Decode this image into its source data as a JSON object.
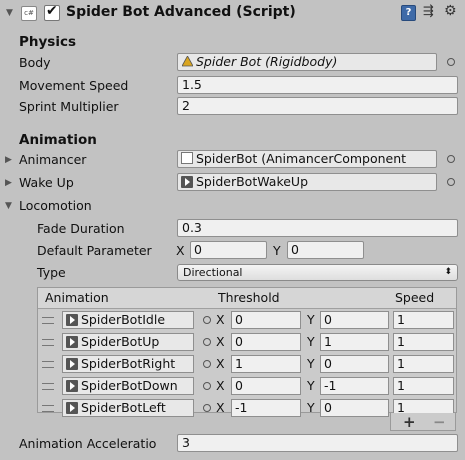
{
  "component": {
    "title": "Spider Bot Advanced (Script)",
    "enabled": true
  },
  "physics": {
    "section_label": "Physics",
    "body": {
      "label": "Body",
      "value": "Spider Bot (Rigidbody)"
    },
    "movement_speed": {
      "label": "Movement Speed",
      "value": "1.5"
    },
    "sprint_multiplier": {
      "label": "Sprint Multiplier",
      "value": "2"
    }
  },
  "animation": {
    "section_label": "Animation",
    "animancer": {
      "label": "Animancer",
      "value": "SpiderBot (AnimancerComponent"
    },
    "wake_up": {
      "label": "Wake Up",
      "value": "SpiderBotWakeUp"
    },
    "locomotion": {
      "label": "Locomotion",
      "fade_duration": {
        "label": "Fade Duration",
        "value": "0.3"
      },
      "default_parameter": {
        "label": "Default Parameter",
        "x_label": "X",
        "x": "0",
        "y_label": "Y",
        "y": "0"
      },
      "type": {
        "label": "Type",
        "value": "Directional"
      },
      "table": {
        "col_animation": "Animation",
        "col_threshold": "Threshold",
        "col_speed": "Speed",
        "x_label": "X",
        "y_label": "Y",
        "rows": [
          {
            "clip": "SpiderBotIdle",
            "x": "0",
            "y": "0",
            "speed": "1"
          },
          {
            "clip": "SpiderBotUp",
            "x": "0",
            "y": "1",
            "speed": "1"
          },
          {
            "clip": "SpiderBotRight",
            "x": "1",
            "y": "0",
            "speed": "1"
          },
          {
            "clip": "SpiderBotDown",
            "x": "0",
            "y": "-1",
            "speed": "1"
          },
          {
            "clip": "SpiderBotLeft",
            "x": "-1",
            "y": "0",
            "speed": "1"
          }
        ],
        "add_label": "+",
        "remove_label": "−"
      }
    },
    "acceleration": {
      "label": "Animation Acceleratio",
      "value": "3"
    }
  }
}
